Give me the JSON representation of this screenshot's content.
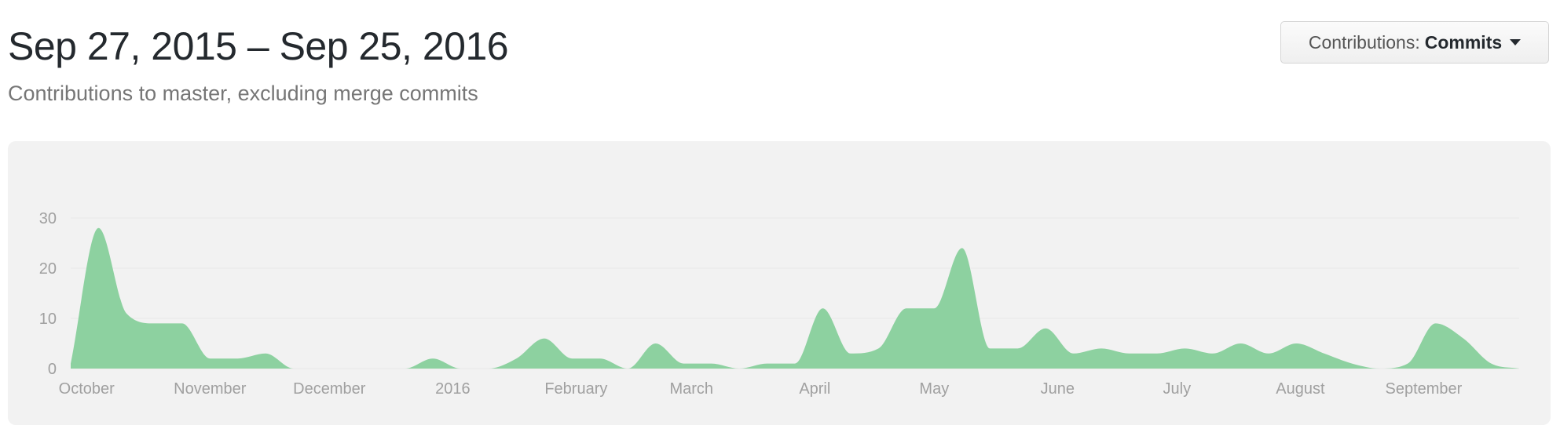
{
  "header": {
    "title": "Sep 27, 2015 – Sep 25, 2016",
    "subtitle": "Contributions to master, excluding merge commits"
  },
  "contributions_button": {
    "label": "Contributions:",
    "value": "Commits",
    "icon": "caret-down-icon"
  },
  "colors": {
    "area_fill": "#8dd1a0",
    "panel_background": "#f2f2f2",
    "axis_text": "#a0a0a0",
    "gridline": "#e8e8e8"
  },
  "chart_data": {
    "type": "area",
    "title": "",
    "xlabel": "",
    "ylabel": "",
    "ylim": [
      0,
      30
    ],
    "yticks": [
      0,
      10,
      20,
      30
    ],
    "grid": true,
    "x_tick_labels": [
      "October",
      "November",
      "December",
      "2016",
      "February",
      "March",
      "April",
      "May",
      "June",
      "July",
      "August",
      "September"
    ],
    "x_tick_dates": [
      "2015-10-01",
      "2015-11-01",
      "2015-12-01",
      "2016-01-01",
      "2016-02-01",
      "2016-03-01",
      "2016-04-01",
      "2016-05-01",
      "2016-06-01",
      "2016-07-01",
      "2016-08-01",
      "2016-09-01"
    ],
    "x_range": [
      "2015-09-27",
      "2016-09-25"
    ],
    "series": [
      {
        "x": [
          "2015-09-27",
          "2015-10-04",
          "2015-10-11",
          "2015-10-18",
          "2015-10-25",
          "2015-11-01",
          "2015-11-08",
          "2015-11-15",
          "2015-11-22",
          "2015-11-29",
          "2015-12-06",
          "2015-12-13",
          "2015-12-20",
          "2015-12-27",
          "2016-01-03",
          "2016-01-10",
          "2016-01-17",
          "2016-01-24",
          "2016-01-31",
          "2016-02-07",
          "2016-02-14",
          "2016-02-21",
          "2016-02-28",
          "2016-03-06",
          "2016-03-13",
          "2016-03-20",
          "2016-03-27",
          "2016-04-03",
          "2016-04-10",
          "2016-04-17",
          "2016-04-24",
          "2016-05-01",
          "2016-05-08",
          "2016-05-15",
          "2016-05-22",
          "2016-05-29",
          "2016-06-05",
          "2016-06-12",
          "2016-06-19",
          "2016-06-26",
          "2016-07-03",
          "2016-07-10",
          "2016-07-17",
          "2016-07-24",
          "2016-07-31",
          "2016-08-07",
          "2016-08-14",
          "2016-08-21",
          "2016-08-28",
          "2016-09-04",
          "2016-09-11",
          "2016-09-18",
          "2016-09-25"
        ],
        "values": [
          1,
          28,
          11,
          9,
          9,
          2,
          2,
          3,
          0,
          0,
          0,
          0,
          0,
          2,
          0,
          0,
          2,
          6,
          2,
          2,
          0,
          5,
          1,
          1,
          0,
          1,
          1,
          12,
          3,
          4,
          12,
          12,
          24,
          4,
          4,
          8,
          3,
          4,
          3,
          3,
          4,
          3,
          5,
          3,
          5,
          3,
          1,
          0,
          1,
          9,
          6,
          1,
          0
        ]
      }
    ]
  }
}
